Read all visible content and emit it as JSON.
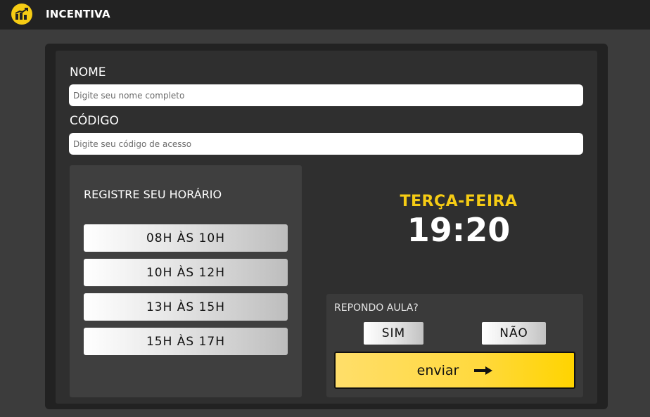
{
  "header": {
    "brand": "INCENTIVA",
    "logo_icon": "chart-growth-icon"
  },
  "form": {
    "name_label": "NOME",
    "name_placeholder": "Digite seu nome completo",
    "name_value": "",
    "code_label": "CÓDIGO",
    "code_placeholder": "Digite seu código de acesso",
    "code_value": ""
  },
  "schedule": {
    "title": "REGISTRE SEU HORÁRIO",
    "slots": [
      {
        "label": "08H ÀS 10H"
      },
      {
        "label": "10H ÀS 12H"
      },
      {
        "label": "13H ÀS 15H"
      },
      {
        "label": "15H ÀS 17H"
      }
    ]
  },
  "clock": {
    "day": "TERÇA-FEIRA",
    "time": "19:20"
  },
  "class_reply": {
    "question": "REPONDO AULA?",
    "yes_label": "SIM",
    "no_label": "NÃO",
    "submit_label": "enviar",
    "submit_icon": "arrow-right-icon"
  },
  "colors": {
    "accent": "#f6cc14",
    "topbar": "#222222",
    "background": "#3c3c3c",
    "card": "#2f2f2f"
  }
}
